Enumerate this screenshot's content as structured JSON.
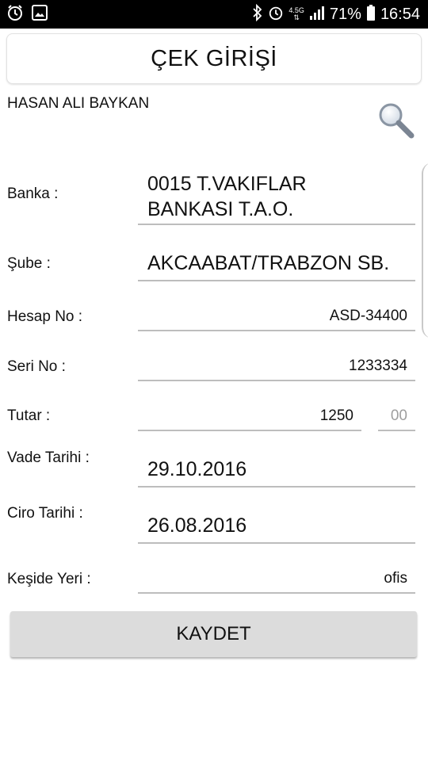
{
  "status_bar": {
    "network_top": "4.5G",
    "network_bottom": "⇅",
    "battery": "71%",
    "time": "16:54"
  },
  "header": {
    "title": "ÇEK GİRİŞİ"
  },
  "user": {
    "name": "HASAN ALI BAYKAN"
  },
  "form": {
    "banka_label": "Banka :",
    "banka_line1": "0015 T.VAKIFLAR",
    "banka_line2": "BANKASI T.A.O.",
    "sube_label": "Şube :",
    "sube_value": "AKCAABAT/TRABZON SB.",
    "hesap_label": "Hesap No :",
    "hesap_value": "ASD-34400",
    "seri_label": "Seri No :",
    "seri_value": "1233334",
    "tutar_label": "Tutar :",
    "tutar_value": "1250",
    "kurus_placeholder": "00",
    "vade_label": "Vade Tarihi :",
    "vade_value": "29.10.2016",
    "ciro_label": "Ciro Tarihi :",
    "ciro_value": "26.08.2016",
    "keside_label": "Keşide Yeri :",
    "keside_value": "ofis"
  },
  "actions": {
    "save_label": "KAYDET"
  },
  "icons": {
    "status_left": [
      "alarm-icon",
      "image-icon"
    ],
    "status_right": [
      "bluetooth-icon",
      "alarm-icon",
      "signal-icon",
      "battery-icon"
    ],
    "search": "search-icon"
  },
  "colors": {
    "status_bar": "#000000",
    "button_bg": "#dcdcdc",
    "underline": "#bdbdbd"
  }
}
